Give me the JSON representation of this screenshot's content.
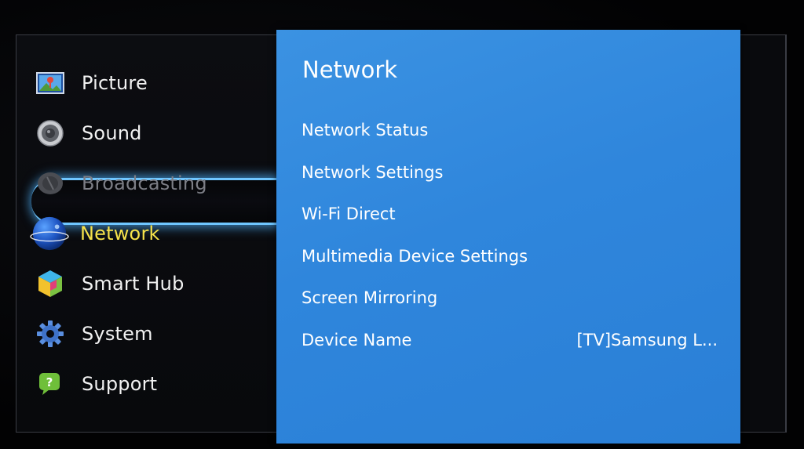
{
  "sidebar": {
    "items": [
      {
        "label": "Picture",
        "icon": "picture-icon",
        "state": "normal"
      },
      {
        "label": "Sound",
        "icon": "speaker-icon",
        "state": "normal"
      },
      {
        "label": "Broadcasting",
        "icon": "satellite-dish-icon",
        "state": "disabled"
      },
      {
        "label": "Network",
        "icon": "globe-icon",
        "state": "selected"
      },
      {
        "label": "Smart Hub",
        "icon": "smart-hub-cube-icon",
        "state": "normal"
      },
      {
        "label": "System",
        "icon": "gear-icon",
        "state": "normal"
      },
      {
        "label": "Support",
        "icon": "help-bubble-icon",
        "state": "normal"
      }
    ]
  },
  "panel": {
    "title": "Network",
    "items": [
      {
        "label": "Network Status",
        "value": ""
      },
      {
        "label": "Network Settings",
        "value": ""
      },
      {
        "label": "Wi-Fi Direct",
        "value": ""
      },
      {
        "label": "Multimedia Device Settings",
        "value": ""
      },
      {
        "label": "Screen Mirroring",
        "value": ""
      },
      {
        "label": "Device Name",
        "value": "[TV]Samsung L..."
      }
    ]
  },
  "colors": {
    "panel_blue": "#2f86dc",
    "selected_text": "#f6e24a",
    "selection_glow": "#6fc6ff",
    "disabled_text": "#7c7e86"
  }
}
